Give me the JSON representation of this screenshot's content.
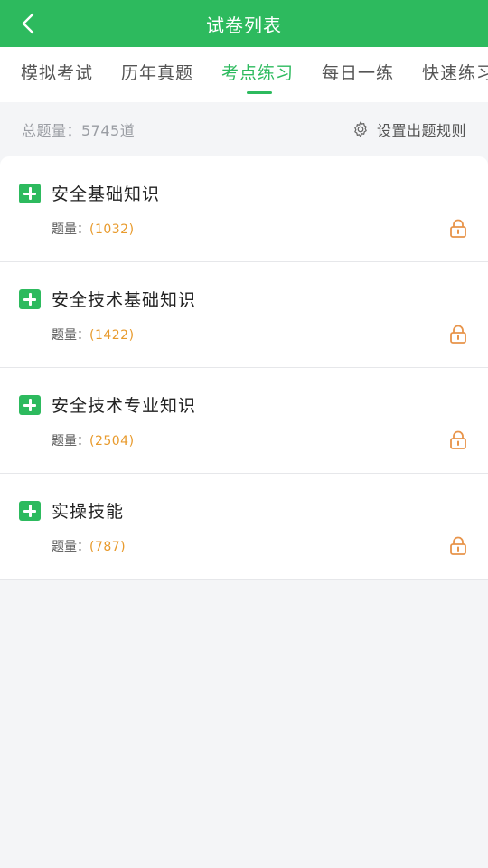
{
  "header": {
    "title": "试卷列表"
  },
  "tabs": [
    {
      "label": "模拟考试"
    },
    {
      "label": "历年真题"
    },
    {
      "label": "考点练习"
    },
    {
      "label": "每日一练"
    },
    {
      "label": "快速练习"
    }
  ],
  "summary": {
    "total_text": "总题量：5745道",
    "rules_label": "设置出题规则"
  },
  "sections": [
    {
      "title": "安全基础知识",
      "count_label": "题量：",
      "count_value": "(1032)"
    },
    {
      "title": "安全技术基础知识",
      "count_label": "题量：",
      "count_value": "(1422)"
    },
    {
      "title": "安全技术专业知识",
      "count_label": "题量：",
      "count_value": "(2504)"
    },
    {
      "title": "实操技能",
      "count_label": "题量：",
      "count_value": "(787)"
    }
  ],
  "colors": {
    "accent": "#2dba5e",
    "count": "#e89a2c",
    "lock": "#e8944a"
  },
  "icons": {
    "back": "chevron-left-icon",
    "settings": "gear-icon",
    "expand": "plus-square-icon",
    "lock": "lock-icon"
  }
}
